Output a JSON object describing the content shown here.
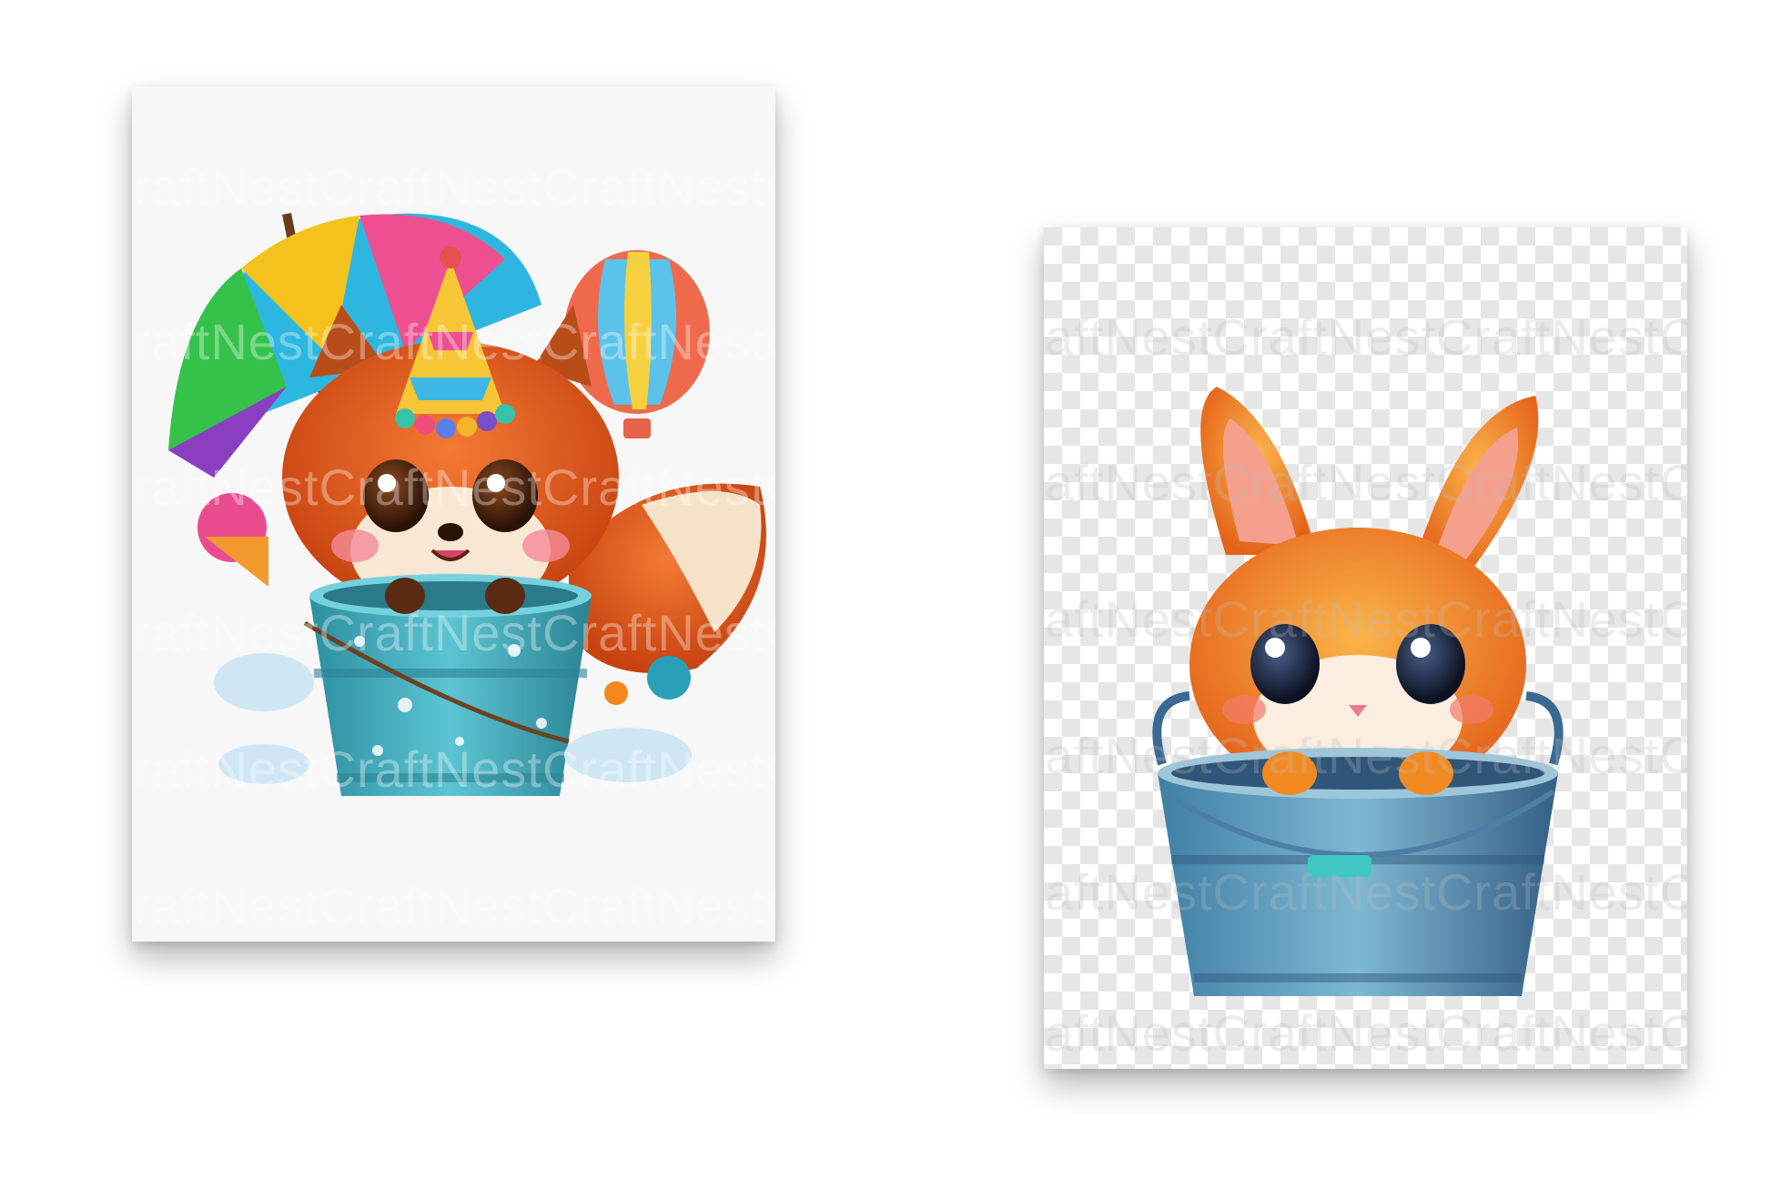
{
  "watermark": {
    "brand": "CraftNestCraftNestCraftNestCraftNest"
  },
  "cards": [
    {
      "subject": "fox-in-bucket",
      "background": "#f7f7f8"
    },
    {
      "subject": "bunny-in-bucket",
      "background": "transparent-checkerboard"
    }
  ],
  "colors": {
    "fox_orange": "#e2571b",
    "bucket_teal": "#3aa8b8",
    "bucket_steel": "#4f8fb5",
    "bunny_orange": "#f08a24"
  }
}
